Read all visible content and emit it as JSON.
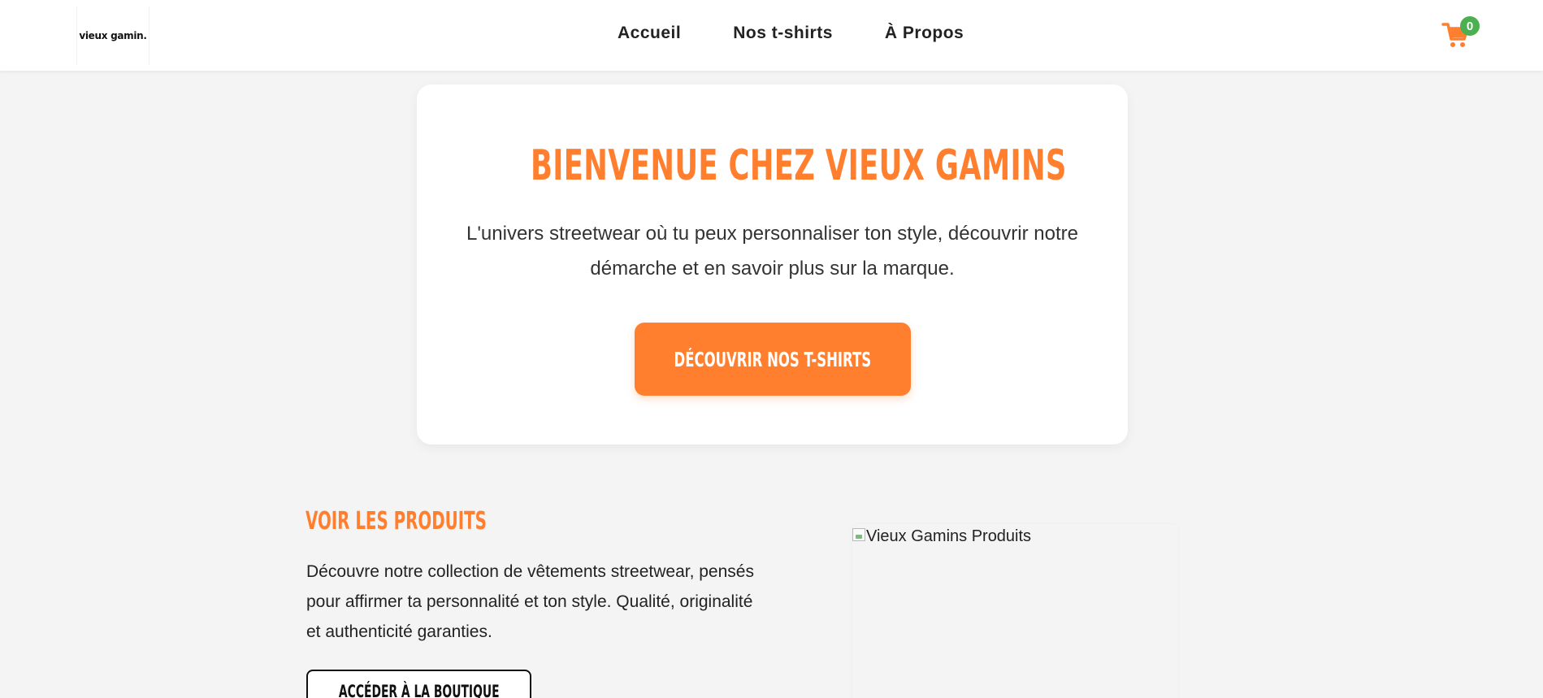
{
  "header": {
    "logo_text": "vieux gamin.",
    "nav": [
      {
        "label": "Accueil"
      },
      {
        "label": "Nos t-shirts"
      },
      {
        "label": "À Propos"
      }
    ],
    "cart_icon": "cart-icon",
    "cart_count": "0"
  },
  "hero": {
    "title": "BIENVENUE CHEZ VIEUX GAMINS",
    "text": "L'univers streetwear où tu peux personnaliser ton style, découvrir notre démarche et en savoir plus sur la marque.",
    "button_label": "DÉCOUVRIR NOS T-SHIRTS"
  },
  "products_section": {
    "title": "VOIR LES PRODUITS",
    "text": "Découvre notre collection de vêtements streetwear, pensés pour affirmer ta personnalité et ton style. Qualité, originalité et authenticité garanties.",
    "button_label": "ACCÉDER À LA BOUTIQUE",
    "image_alt": "Vieux Gamins Produits"
  },
  "colors": {
    "accent": "#ff7f2f",
    "badge": "#4caf50",
    "background": "#f4f4f4"
  }
}
